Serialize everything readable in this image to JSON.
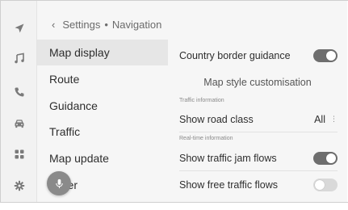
{
  "breadcrumb": {
    "parent": "Settings",
    "separator": "•",
    "current": "Navigation"
  },
  "rail": {
    "icons": [
      "navigation-arrow-icon",
      "music-note-icon",
      "phone-icon",
      "car-icon",
      "apps-grid-icon",
      "settings-gear-icon"
    ]
  },
  "menu": {
    "items": [
      {
        "label": "Map display",
        "active": true
      },
      {
        "label": "Route",
        "active": false
      },
      {
        "label": "Guidance",
        "active": false
      },
      {
        "label": "Traffic",
        "active": false
      },
      {
        "label": "Map update",
        "active": false
      },
      {
        "label": "Other",
        "active": false
      }
    ]
  },
  "voice_button": {
    "icon": "microphone-icon"
  },
  "settings": {
    "country_border": {
      "label": "Country border guidance",
      "on": true
    },
    "map_style_header": "Map style customisation",
    "traffic_info_label": "Traffic information",
    "road_class": {
      "label": "Show road class",
      "value": "All",
      "more": "⋮"
    },
    "realtime_label": "Real-time information",
    "traffic_jam": {
      "label": "Show traffic jam flows",
      "on": true
    },
    "free_traffic": {
      "label": "Show free traffic flows",
      "on": false
    }
  },
  "colors": {
    "toggle_on": "#6e6e6e",
    "toggle_off": "#d9d9d9",
    "active_menu": "#e6e6e6",
    "panel": "#f6f6f6"
  }
}
